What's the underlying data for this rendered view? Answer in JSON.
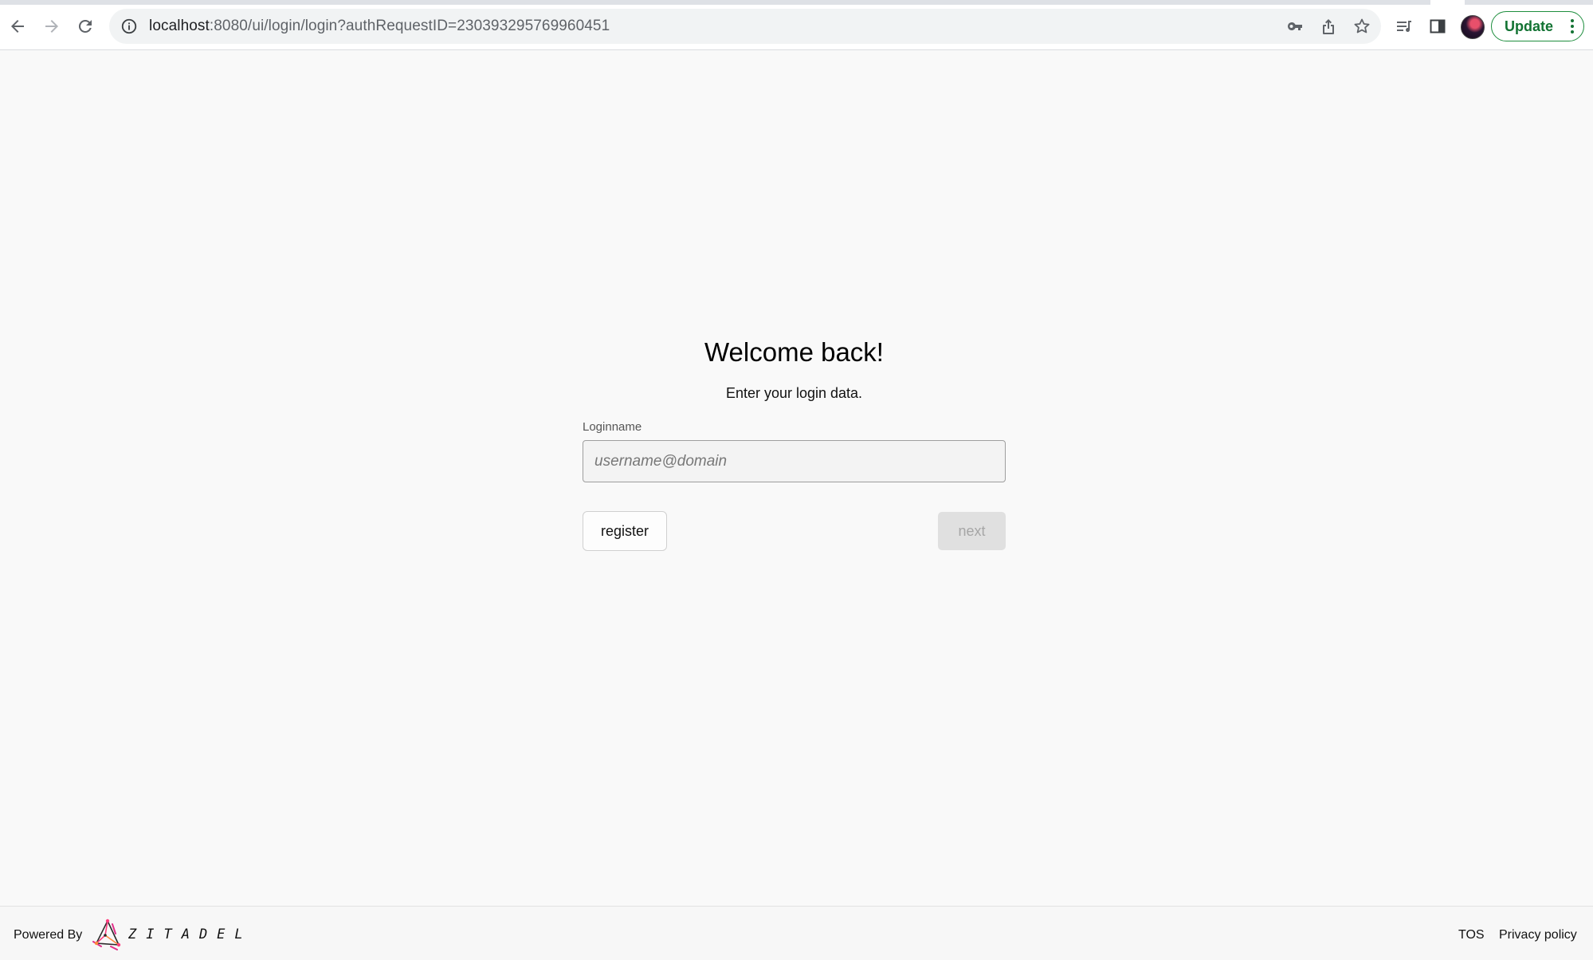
{
  "browser": {
    "url_host": "localhost",
    "url_path": ":8080/ui/login/login?authRequestID=230393295769960451",
    "update_label": "Update",
    "icons": [
      "back-arrow-icon",
      "forward-arrow-icon",
      "reload-icon",
      "info-icon",
      "key-icon",
      "share-icon",
      "star-icon",
      "reading-list-icon",
      "side-panel-icon",
      "avatar",
      "more-vert-icon"
    ]
  },
  "login": {
    "title": "Welcome back!",
    "subtitle": "Enter your login data.",
    "loginname_label": "Loginname",
    "loginname_value": "",
    "loginname_placeholder": "username@domain",
    "register_label": "register",
    "next_label": "next"
  },
  "footer": {
    "powered_by": "Powered By",
    "brand": "ZITADEL",
    "tos": "TOS",
    "privacy": "Privacy policy"
  }
}
